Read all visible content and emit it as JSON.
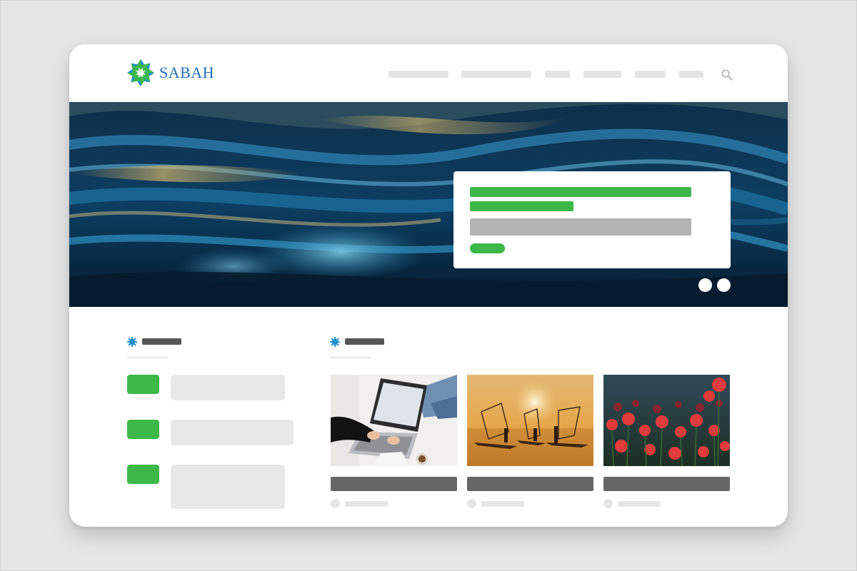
{
  "header": {
    "brand": "SABAH",
    "nav_items": [
      "",
      "",
      "",
      "",
      "",
      ""
    ],
    "search_icon": "search-icon"
  },
  "hero": {
    "carousel_slides": 2
  },
  "colors": {
    "accent": "#3cb84a",
    "brand_blue": "#1f6fb8",
    "placeholder": "#e8e8e8",
    "heading_placeholder": "#555555"
  },
  "sections": {
    "list": {
      "icon": "star-burst-icon",
      "items": 3
    },
    "gallery": {
      "icon": "star-burst-icon",
      "cards": [
        {
          "image": "laptop-photo"
        },
        {
          "image": "fishermen-sunset-photo"
        },
        {
          "image": "poppy-field-photo"
        }
      ]
    }
  }
}
